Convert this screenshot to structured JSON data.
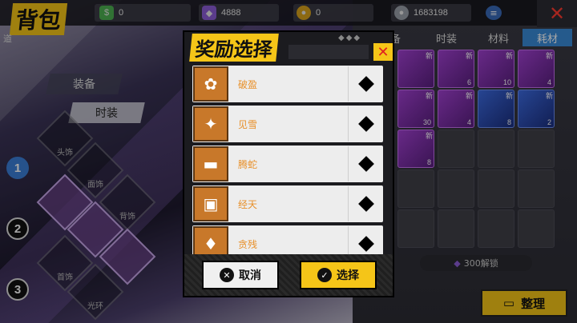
{
  "page_title": "背包",
  "side_tag": "道",
  "currencies": [
    {
      "icon": "cash-icon",
      "value": "0"
    },
    {
      "icon": "purple-crystal-icon",
      "value": "4888"
    },
    {
      "icon": "gold-coin-icon",
      "value": "0"
    },
    {
      "icon": "silver-coin-icon",
      "value": "1683198"
    }
  ],
  "menu_icon": "list-icon",
  "close_icon": "✕",
  "left_tabs": [
    "装备",
    "时装"
  ],
  "steps": [
    "1",
    "2",
    "3"
  ],
  "slot_labels": [
    "头饰",
    "面饰",
    "背饰",
    "首饰",
    "光环"
  ],
  "right_tabs": [
    "装备",
    "时装",
    "材料",
    "耗材"
  ],
  "new_label": "新",
  "inventory_counts": [
    "",
    "6",
    "10",
    "4",
    "",
    "",
    "30",
    "4",
    "8",
    "2",
    "8"
  ],
  "unlock_label": "300解锁",
  "sort_label": "整理",
  "modal": {
    "title": "奖励选择",
    "close": "✕",
    "rewards": [
      {
        "name": "破盈",
        "icon": "necklace-icon"
      },
      {
        "name": "见雪",
        "icon": "pendant-icon"
      },
      {
        "name": "腾蛇",
        "icon": "belt-icon"
      },
      {
        "name": "经天",
        "icon": "armband-icon"
      },
      {
        "name": "贪残",
        "icon": "talisman-icon"
      }
    ],
    "cancel_label": "取消",
    "confirm_label": "选择"
  },
  "colors": {
    "accent": "#f5c518",
    "active_tab": "#3a8ad8",
    "danger": "#e02020",
    "reward_text": "#e8902a"
  }
}
